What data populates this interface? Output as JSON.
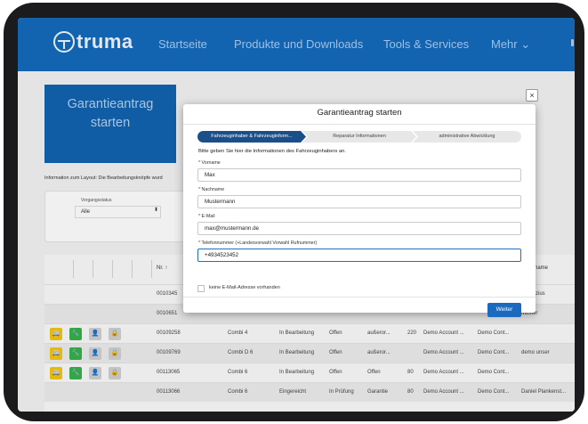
{
  "header": {
    "logo": "truma",
    "nav": [
      "Startseite",
      "Produkte und Downloads",
      "Tools & Services",
      "Mehr ⌄"
    ]
  },
  "page": {
    "title_line1": "Garantieantrag",
    "title_line2": "starten",
    "info": "Information zum Layout: Die Bearbeitungsknöpfe wurd",
    "filter_label": "Vorgangsstatus",
    "filter_value": "Alle",
    "col_nr": "Nr. ↑",
    "col_name": "name"
  },
  "table": {
    "rows": [
      {
        "nr": "0010345",
        "product": "",
        "status": "",
        "state": "",
        "type": "",
        "amount": "",
        "account": "",
        "contact": "",
        "name": "Demozius",
        "icons": false
      },
      {
        "nr": "0010651",
        "product": "",
        "status": "",
        "state": "",
        "type": "",
        "amount": "",
        "account": "",
        "contact": "",
        "name": "Muster",
        "icons": false
      },
      {
        "nr": "00109258",
        "product": "Combi 4",
        "status": "In Bearbeitung",
        "state": "Offen",
        "type": "außeror...",
        "amount": "220",
        "account": "Demo Account ...",
        "contact": "Demo Cont...",
        "name": "",
        "icons": true
      },
      {
        "nr": "00109769",
        "product": "Combi D 6",
        "status": "In Bearbeitung",
        "state": "Offen",
        "type": "außeror...",
        "amount": "",
        "account": "Demo Account ...",
        "contact": "Demo Cont...",
        "name": "demo unser",
        "icons": true
      },
      {
        "nr": "00113065",
        "product": "Combi 6",
        "status": "In Bearbeitung",
        "state": "Offen",
        "type": "Offen",
        "amount": "80",
        "account": "Demo Account ...",
        "contact": "Demo Cont...",
        "name": "",
        "icons": true
      },
      {
        "nr": "00113066",
        "product": "Combi 6",
        "status": "Eingereicht",
        "state": "In Prüfung",
        "type": "Garantie",
        "amount": "80",
        "account": "Demo Account ...",
        "contact": "Demo Cont...",
        "name": "Daniel Plankenst...",
        "icons": false
      }
    ]
  },
  "modal": {
    "title": "Garantieantrag starten",
    "close": "×",
    "steps": [
      "Fahrzeuginhaber & Fahrzeuginform...",
      "Reparatur Informationen",
      "administrative Abwicklung"
    ],
    "description": "Bitte geben Sie hier die Informationen des Fahrzeuginhabers an.",
    "fields": [
      {
        "label": "Vorname",
        "value": "Max"
      },
      {
        "label": "Nachname",
        "value": "Mustermann"
      },
      {
        "label": "E-Mail",
        "value": "max@mustermann.de"
      },
      {
        "label": "Telefonnummer (+Landesvorwahl Vorwahl Rufnummer)",
        "value": "+4934523452"
      }
    ],
    "checkbox_label": "keine E-Mail-Adresse vorhanden",
    "next_button": "Weiter"
  },
  "colors": {
    "brand_blue": "#1263b0",
    "step_active": "#1b4f8a",
    "button": "#1a6abf"
  }
}
